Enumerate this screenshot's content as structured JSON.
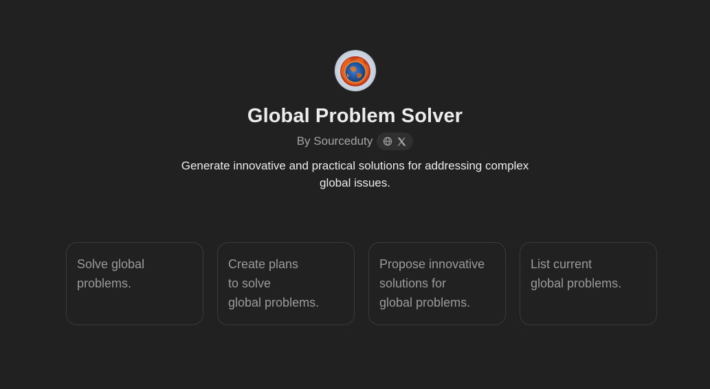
{
  "gpt": {
    "title": "Global Problem Solver",
    "byline": "By Sourceduty",
    "description": "Generate innovative and practical solutions for addressing complex global issues."
  },
  "icons": {
    "avatar": "burning-globe-avatar",
    "website": "globe-icon",
    "social": "x-logo-icon"
  },
  "conversation_starters": [
    "Solve global\nproblems.",
    "Create plans\nto solve\nglobal problems.",
    "Propose innovative\nsolutions for\nglobal problems.",
    "List current\nglobal problems."
  ],
  "colors": {
    "background": "#212121",
    "text_primary": "#ececec",
    "text_muted": "#9b9b9b",
    "card_border": "#3a3a3a",
    "pill_bg": "#2f2f2f"
  }
}
